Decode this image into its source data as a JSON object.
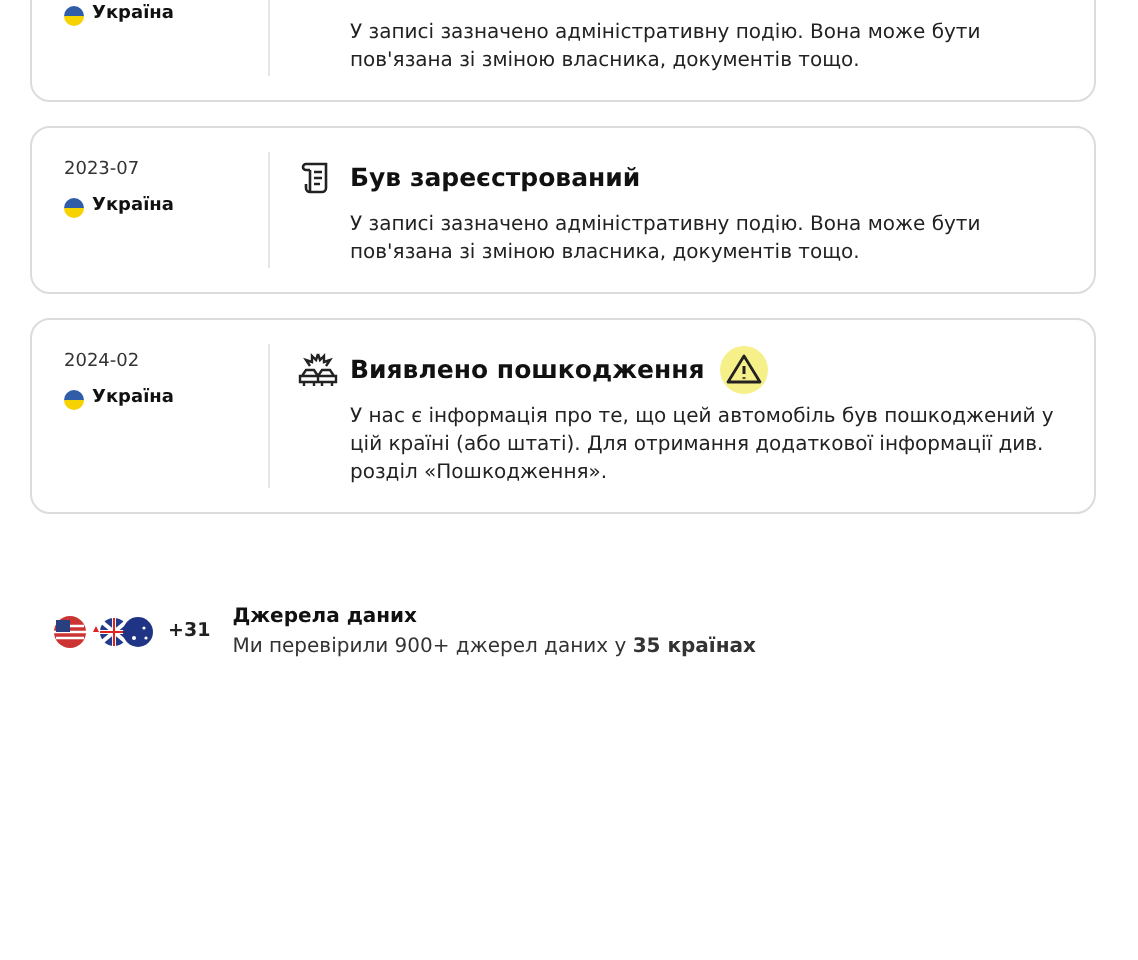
{
  "events": [
    {
      "kind": "admin",
      "country": "Україна",
      "description": "У записі зазначено адміністративну подію. Вона може бути пов'язана зі зміною власника, документів тощо."
    },
    {
      "kind": "registered",
      "date": "2023-07",
      "country": "Україна",
      "title": "Був зареєстрований",
      "description": "У записі зазначено адміністративну подію. Вона може бути пов'язана зі зміною власника, документів тощо.",
      "warning": false
    },
    {
      "kind": "damage",
      "date": "2024-02",
      "country": "Україна",
      "title": "Виявлено пошкодження",
      "description": "У нас є інформація про те, що цей автомобіль був пошкоджений у цій країні (або штаті). Для отримання додаткової інформації див. розділ «Пошкодження».",
      "warning": true
    }
  ],
  "sources": {
    "more_count": "+31",
    "title": "Джерела даних",
    "text": "Ми перевірили 900+ джерел даних у **35 країнах**"
  }
}
